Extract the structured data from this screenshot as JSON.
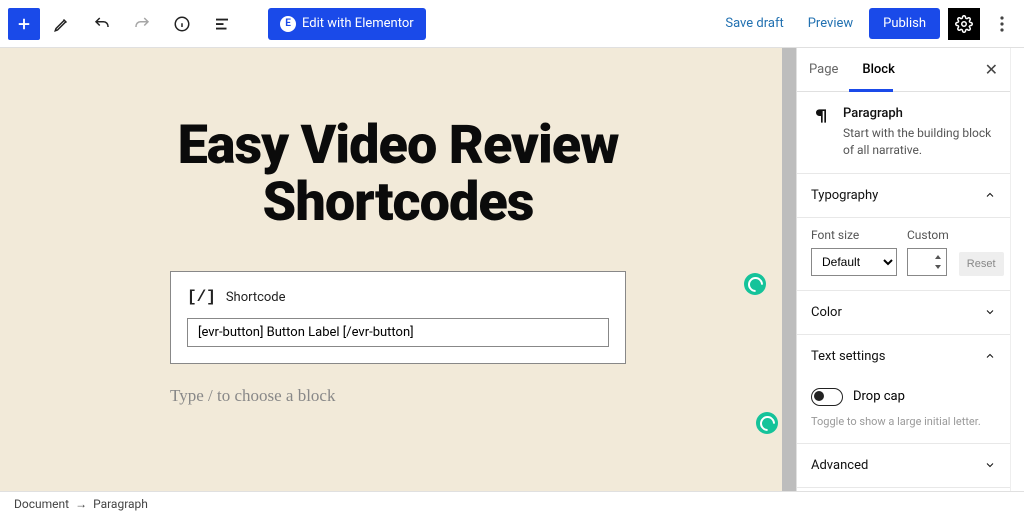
{
  "topbar": {
    "edit_elementor": "Edit with Elementor",
    "save_draft": "Save draft",
    "preview": "Preview",
    "publish": "Publish"
  },
  "post": {
    "title": "Easy Video Review Shortcodes",
    "shortcode_label": "Shortcode",
    "shortcode_value": "[evr-button] Button Label [/evr-button]",
    "block_placeholder": "Type / to choose a block"
  },
  "sidebar": {
    "tabs": {
      "page": "Page",
      "block": "Block"
    },
    "block": {
      "name": "Paragraph",
      "description": "Start with the building block of all narrative."
    },
    "typography": {
      "heading": "Typography",
      "font_size_label": "Font size",
      "font_size_value": "Default",
      "custom_label": "Custom",
      "reset": "Reset"
    },
    "color": {
      "heading": "Color"
    },
    "text_settings": {
      "heading": "Text settings",
      "drop_cap": "Drop cap",
      "hint": "Toggle to show a large initial letter."
    },
    "advanced": {
      "heading": "Advanced"
    }
  },
  "footer": {
    "crumb1": "Document",
    "sep": "→",
    "crumb2": "Paragraph"
  }
}
